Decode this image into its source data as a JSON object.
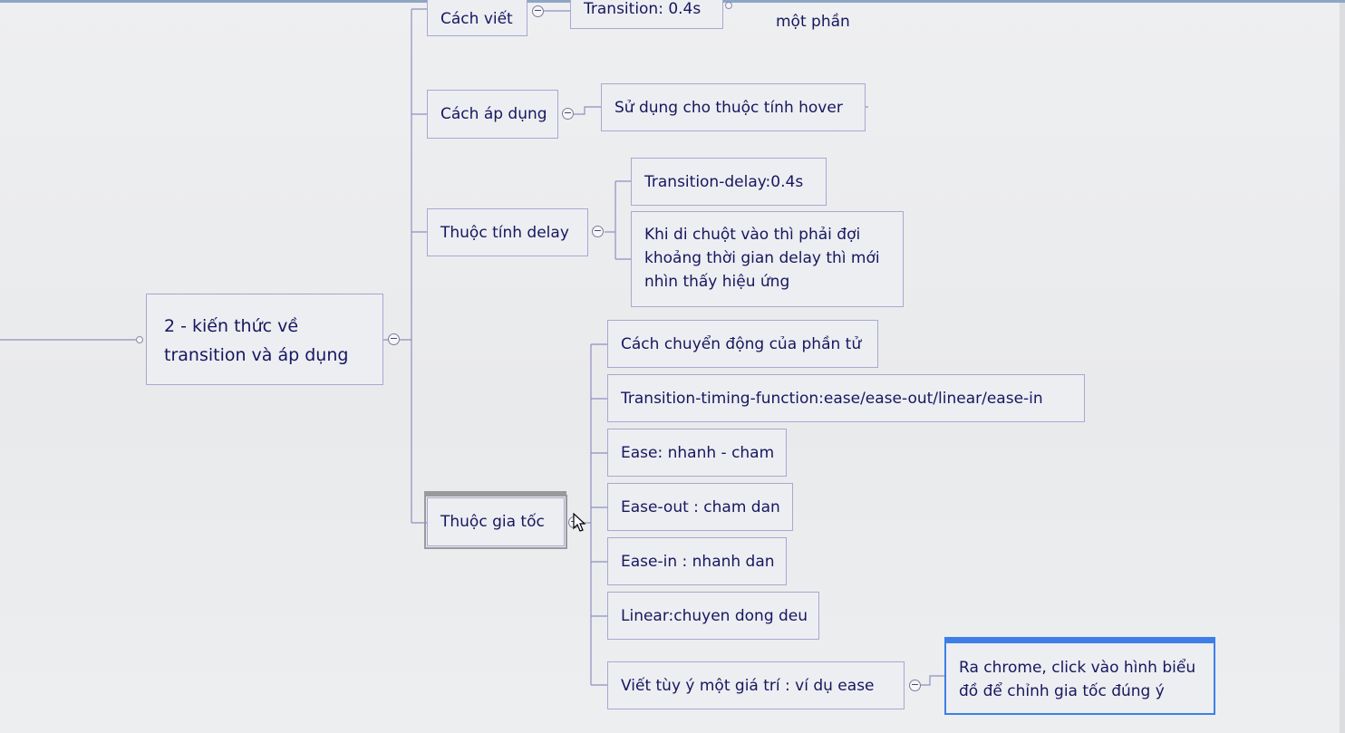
{
  "mindmap": {
    "root": {
      "label": "2 - kiến thức về transition và áp dụng"
    },
    "branches": [
      {
        "label": "Cách viết",
        "children": [
          "Transition: 0.4s"
        ],
        "extra_text": "một phần"
      },
      {
        "label": "Cách áp dụng",
        "children": [
          "Sử dụng cho thuộc tính hover"
        ]
      },
      {
        "label": "Thuộc tính delay",
        "children": [
          "Transition-delay:0.4s",
          "Khi di chuột vào thì phải đợi khoảng thời gian delay thì mới nhìn thấy hiệu ứng"
        ]
      },
      {
        "label": "Thuộc gia tốc",
        "children": [
          "Cách chuyển động của phần tử",
          "Transition-timing-function:ease/ease-out/linear/ease-in",
          "Ease: nhanh - cham",
          "Ease-out : cham dan",
          "Ease-in : nhanh dan",
          "Linear:chuyen dong deu",
          "Viết tùy ý một giá trí : ví dụ ease"
        ],
        "subchild": "Ra chrome, click vào hình biểu đồ để chỉnh gia tốc đúng ý"
      }
    ],
    "toggle_symbol": "−"
  },
  "colors": {
    "node_border": "#a8a8d2",
    "node_text": "#17175e",
    "line": "#8f8fc0",
    "selection_blue": "#3d7fe6",
    "selection_grey": "#9a9a9a"
  }
}
